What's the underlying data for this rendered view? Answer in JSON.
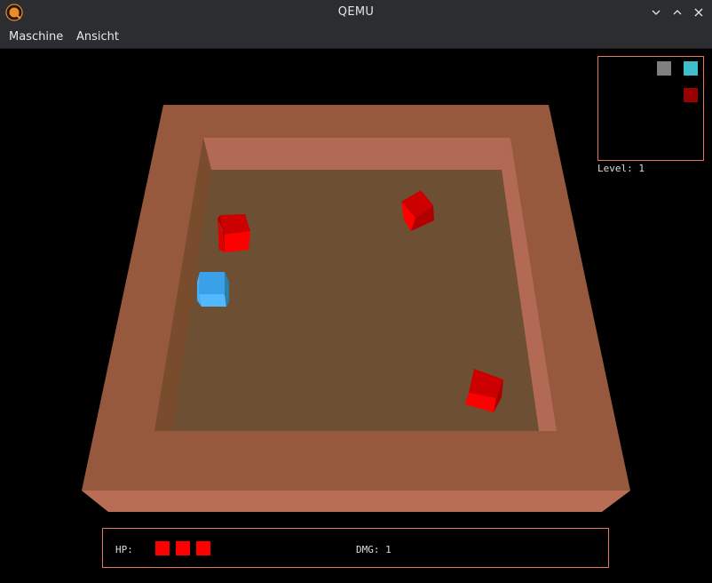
{
  "window": {
    "title": "QEMU",
    "icon": "qemu-logo-icon",
    "controls": [
      "minimize-icon",
      "maximize-icon",
      "close-icon"
    ]
  },
  "menu": {
    "items": [
      {
        "label": "Maschine"
      },
      {
        "label": "Ansicht"
      }
    ]
  },
  "game": {
    "level_text": "Level: 1",
    "hud": {
      "hp_label": "HP:",
      "hp_value": 3,
      "dmg_text": "DMG: 1"
    },
    "minimap_cells": [
      {
        "color": "#808080"
      },
      {
        "color": "#3fbfcc"
      },
      {
        "color": "#990000"
      }
    ],
    "colors": {
      "arena_floor": "#6d4f34",
      "arena_wall_top": "#97593e",
      "arena_wall_inner": "#b36a55",
      "enemy": "#ff0000",
      "player": "#3aa0e8",
      "hud_border": "#e07a5a"
    }
  }
}
